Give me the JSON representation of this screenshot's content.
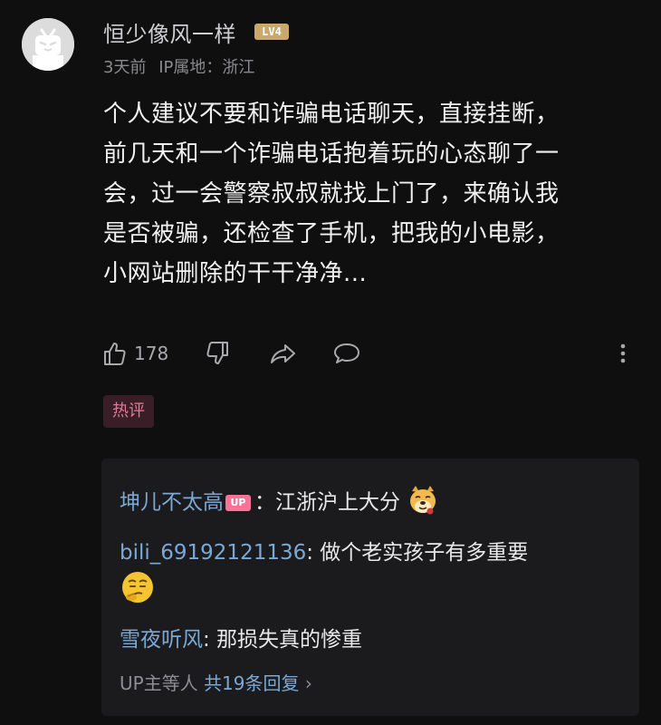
{
  "comment": {
    "username": "恒少像风一样",
    "level": "LV4",
    "time": "3天前",
    "ip_location": "IP属地：浙江",
    "lines": [
      "个人建议不要和诈骗电话聊天，直接挂断，",
      "前几天和一个诈骗电话抱着玩的心态聊了一",
      "会，过一会警察叔叔就找上门了，来确认我",
      "是否被骗，还检查了手机，把我的小电影，",
      "小网站删除的干干净净..."
    ],
    "likes": "178",
    "tag": "热评"
  },
  "replies": [
    {
      "name": "坤儿不太高",
      "badge": "UP",
      "text": "：江浙沪上大分"
    },
    {
      "name": "bili_69192121136",
      "text": ": 做个老实孩子有多重要"
    },
    {
      "name": "雪夜听风",
      "text": ": 那损失真的惨重"
    }
  ],
  "more_replies": {
    "prefix": "UP主等人",
    "count_label": "共19条回复",
    "chevron": "›"
  },
  "icons": [
    "avatar-tv-icon",
    "thumb-up-icon",
    "thumb-down-icon",
    "share-icon",
    "chat-icon",
    "more-vertical-icon",
    "doge-emoji",
    "thinking-emoji"
  ],
  "colors": {
    "background": "#0f0f10",
    "reply_panel": "#1b1b1d",
    "link_blue": "#7ba9d6",
    "hot_tag_bg": "#3a1e27",
    "hot_tag_text": "#e07b97",
    "up_badge": "#fb7299",
    "level_badge": "#caa86a"
  }
}
